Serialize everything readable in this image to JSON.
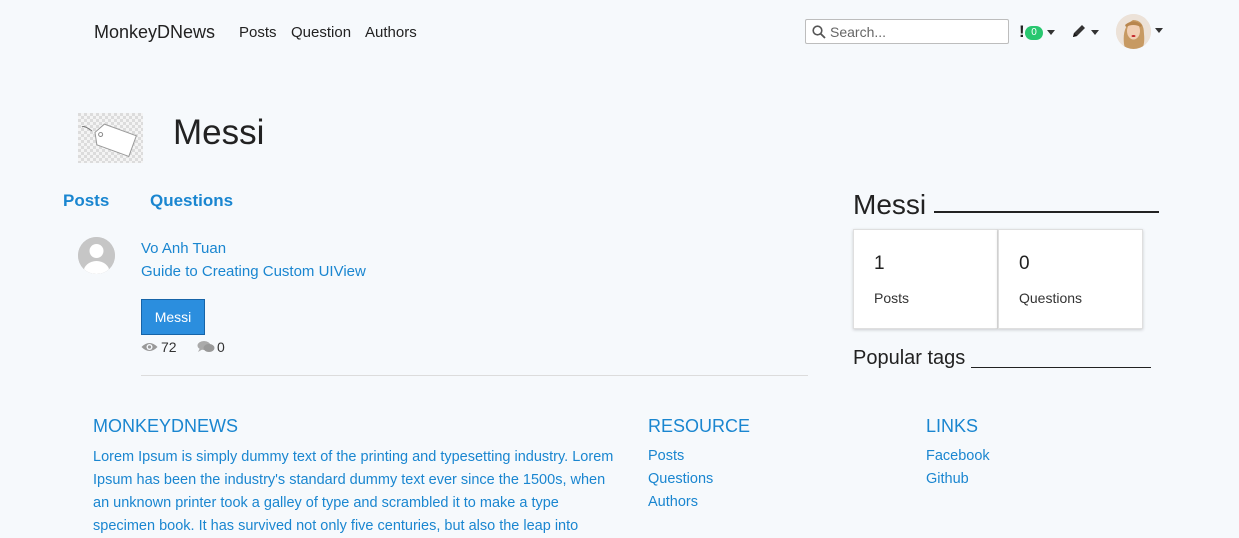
{
  "navbar": {
    "brand": "MonkeyDNews",
    "links": [
      "Posts",
      "Question",
      "Authors"
    ],
    "search_placeholder": "Search...",
    "notification_symbol": "!",
    "notification_count": "0",
    "icons": [
      "search-icon",
      "notification-icon",
      "pencil-icon",
      "user-avatar"
    ]
  },
  "tag": {
    "name": "Messi",
    "tabs": [
      "Posts",
      "Questions"
    ]
  },
  "post": {
    "author": "Vo Anh Tuan",
    "title": "Guide to Creating Custom UIView",
    "tag": "Messi",
    "views": "72",
    "comments": "0"
  },
  "sidebar": {
    "title": "Messi",
    "stats": [
      {
        "value": "1",
        "label": "Posts"
      },
      {
        "value": "0",
        "label": "Questions"
      }
    ],
    "popular_tags_title": "Popular tags"
  },
  "footer": {
    "about_heading": "MONKEYDNEWS",
    "about_text": "Lorem Ipsum is simply dummy text of the printing and typesetting industry. Lorem Ipsum has been the industry's standard dummy text ever since the 1500s, when an unknown printer took a galley of type and scrambled it to make a type specimen book. It has survived not only five centuries, but also the leap into",
    "resource_heading": "RESOURCE",
    "resource_links": [
      "Posts",
      "Questions",
      "Authors"
    ],
    "links_heading": "LINKS",
    "links": [
      "Facebook",
      "Github"
    ]
  },
  "colors": {
    "accent": "#1a86d0",
    "badge": "#28c76f",
    "button": "#2b8ede",
    "background": "#f6f9fc"
  }
}
